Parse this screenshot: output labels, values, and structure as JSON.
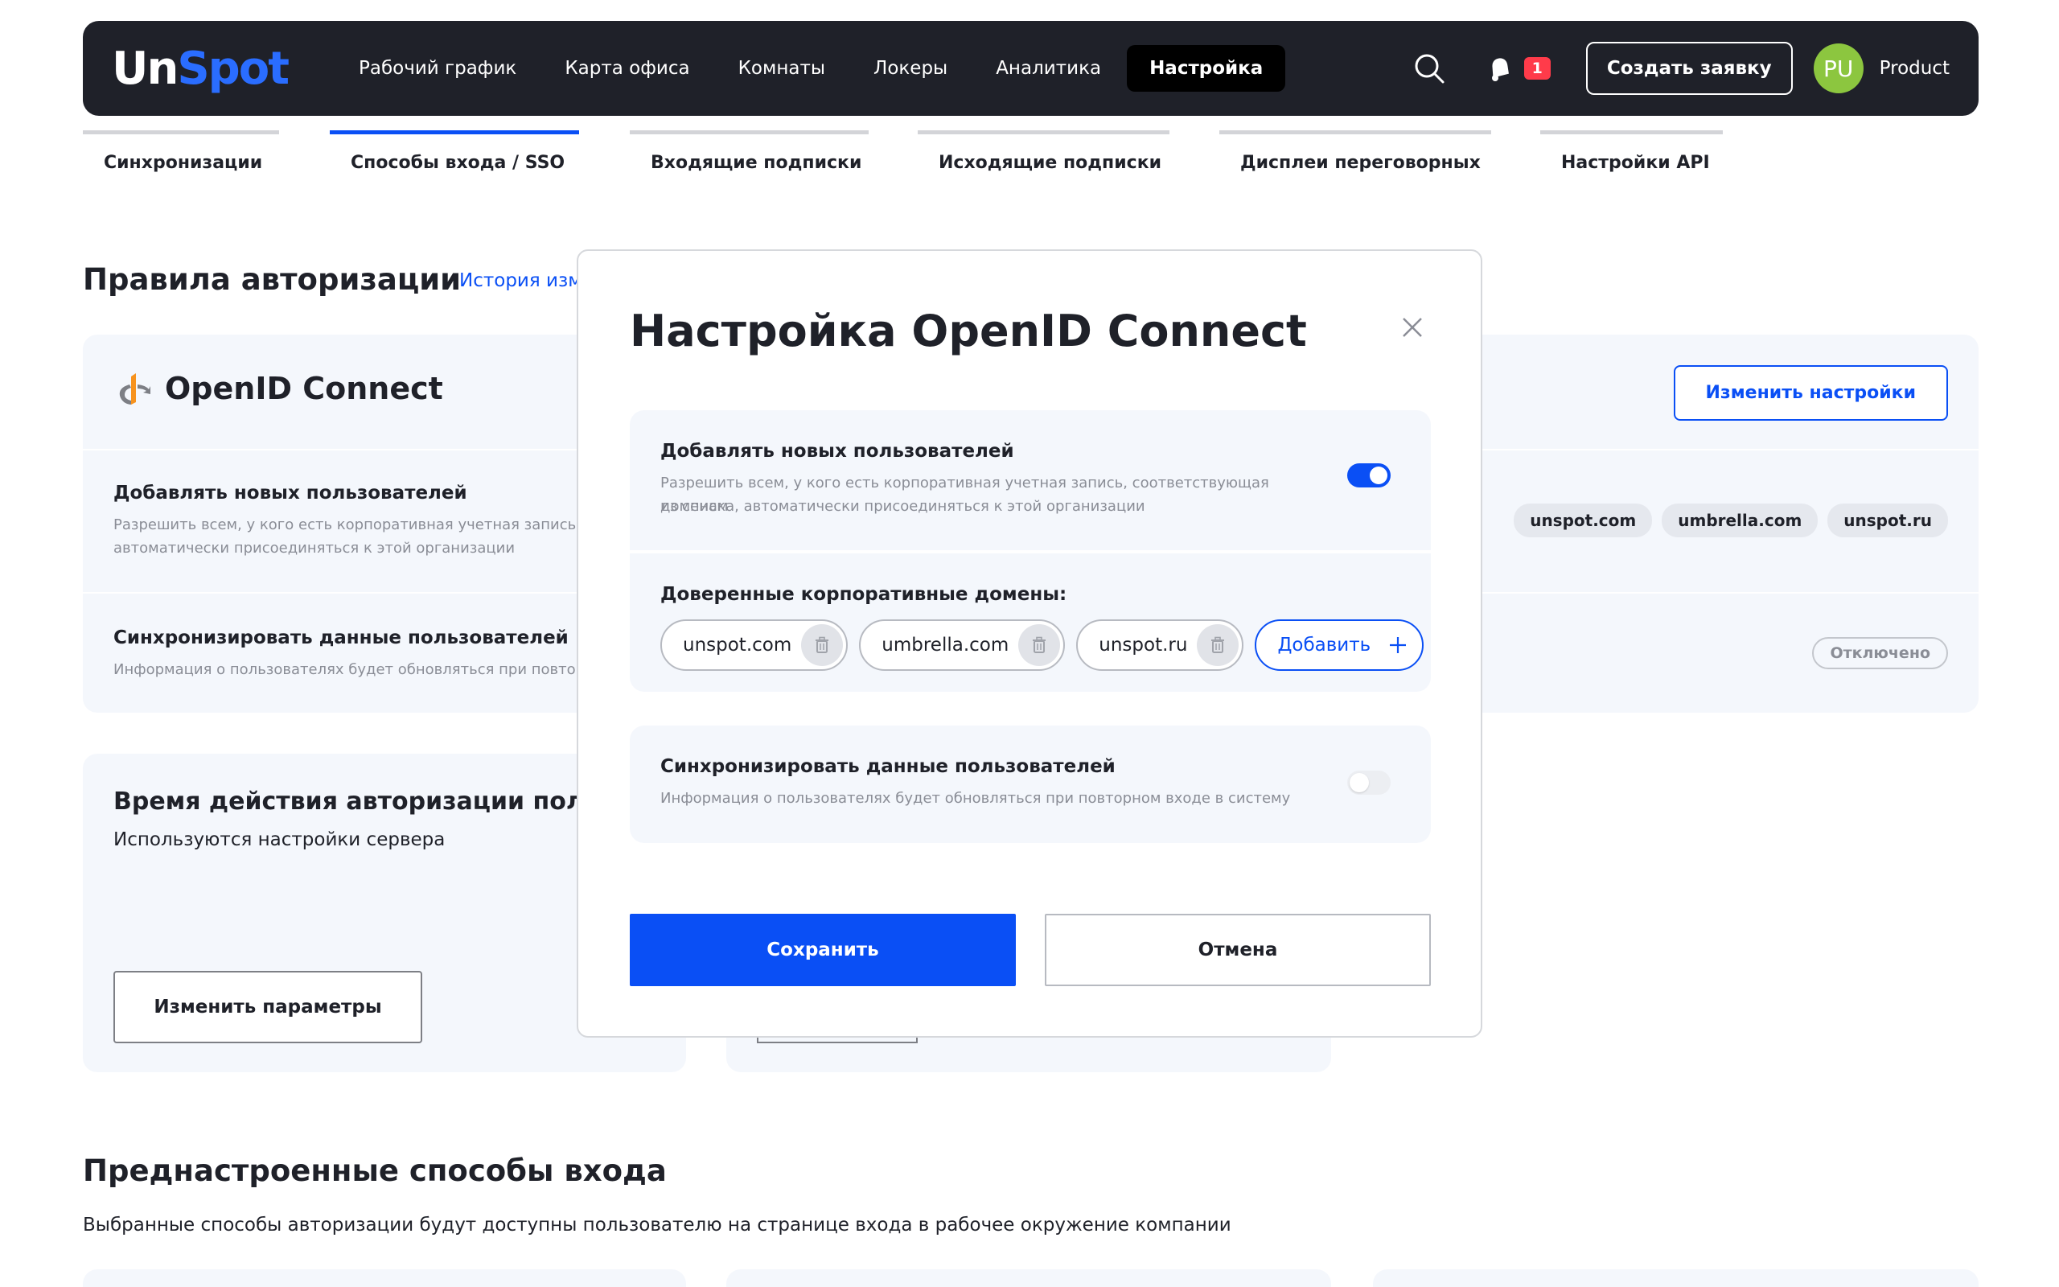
{
  "header": {
    "logo_un": "Un",
    "logo_spot": "Spot",
    "nav": [
      "Рабочий график",
      "Карта офиса",
      "Комнаты",
      "Локеры",
      "Аналитика",
      "Настройка"
    ],
    "notifications_count": "1",
    "create_button": "Создать заявку",
    "avatar_initials": "PU",
    "user_name": "Product"
  },
  "tabs": [
    "Синхронизации",
    "Способы входа / SSO",
    "Входящие подписки",
    "Исходящие подписки",
    "Дисплеи переговорных",
    "Настройки API"
  ],
  "auth_rules": {
    "title": "Правила авторизации",
    "history_link": "История изм",
    "provider_name": "OpenID Connect",
    "change_button": "Изменить настройки",
    "add_users_title": "Добавлять новых пользователей",
    "add_users_desc_line1": "Разрешить всем, у кого есть корпоративная учетная запись, соо",
    "add_users_desc_line2": "автоматически присоединяться к этой организации",
    "domains": [
      "unspot.com",
      "umbrella.com",
      "unspot.ru"
    ],
    "sync_title": "Синхронизировать данные пользователей",
    "sync_desc": "Информация о пользователях будет обновляться при повторно",
    "sync_status": "Отключено"
  },
  "session_card": {
    "title": "Время действия авторизации пользова",
    "subtitle": "Используются настройки сервера",
    "button": "Изменить параметры"
  },
  "preset": {
    "title": "Преднастроенные способы входа",
    "subtitle": "Выбранные способы авторизации будут доступны пользователю на странице входа в рабочее окружение компании"
  },
  "modal": {
    "title": "Настройка OpenID Connect",
    "add_users_title": "Добавлять новых пользователей",
    "add_users_desc_line1": "Разрешить всем, у кого есть корпоративная учетная запись, соответствующая доменам",
    "add_users_desc_line2": "из списка, автоматически присоединяться к этой организации",
    "add_users_enabled": true,
    "trusted_domains_title": "Доверенные корпоративные домены:",
    "domains": [
      "unspot.com",
      "umbrella.com",
      "unspot.ru"
    ],
    "add_domain_label": "Добавить",
    "sync_title": "Синхронизировать данные пользователей",
    "sync_desc": "Информация о пользователях будет обновляться при повторном входе в систему",
    "sync_enabled": false,
    "save_button": "Сохранить",
    "cancel_button": "Отмена"
  },
  "colors": {
    "header_bg": "#1f2129",
    "accent": "#0a4ff5",
    "badge": "#ff3b4a",
    "avatar": "#8cc63f",
    "card_bg": "#f4f7fc"
  }
}
